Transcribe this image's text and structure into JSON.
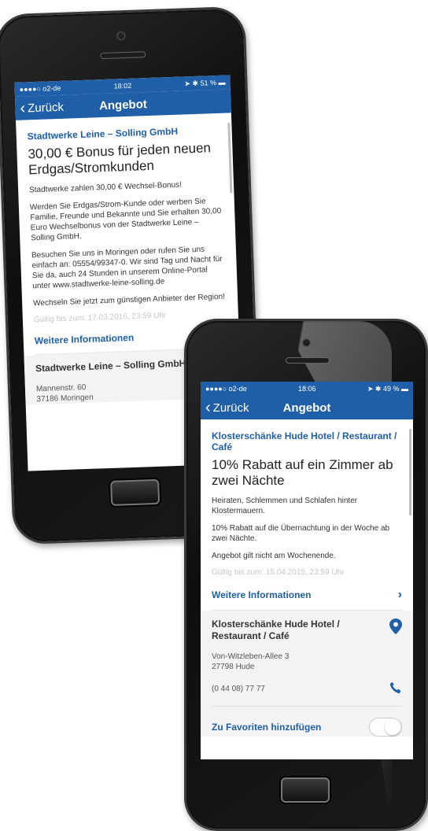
{
  "colors": {
    "accent": "#1f5fa8",
    "pin_icon": "#1f5fa8",
    "muted": "#c6c6c6"
  },
  "phone1": {
    "status": {
      "carrier": "●●●●○ o2-de",
      "time": "18:02",
      "battery": "51 %"
    },
    "nav": {
      "back_label": "Zurück",
      "title": "Angebot"
    },
    "offer": {
      "provider": "Stadtwerke Leine – Solling GmbH",
      "headline": "30,00 € Bonus für jeden neuen Erdgas/Stromkunden",
      "p1": "Stadtwerke zahlen 30,00 € Wechsel-Bonus!",
      "p2": "Werden Sie Erdgas/Strom-Kunde oder werben Sie Familie, Freunde und Bekannte und Sie erhalten 30,00 Euro Wechselbonus von der Stadtwerke Leine – Solling GmbH.",
      "p3": "Besuchen Sie uns in Moringen oder rufen Sie uns einfach an: 05554/99347-0. Wir sind Tag und Nacht für Sie da, auch 24 Stunden in unserem Online-Portal unter www.stadtwerke-leine-solling.de",
      "p4": "Wechseln Sie jetzt zum günstigen Anbieter der Region!",
      "valid": "Gültig bis zum: 17.03.2016, 23:59 Uhr",
      "more_label": "Weitere Informationen"
    },
    "address": {
      "name": "Stadtwerke Leine – Solling GmbH",
      "street": "Mannenstr. 60",
      "city": "37186 Moringen"
    }
  },
  "phone2": {
    "status": {
      "carrier": "●●●●○ o2-de",
      "time": "18:06",
      "battery": "49 %"
    },
    "nav": {
      "back_label": "Zurück",
      "title": "Angebot"
    },
    "offer": {
      "provider": "Klosterschänke Hude Hotel / Restaurant / Café",
      "headline": "10% Rabatt auf ein Zimmer ab zwei Nächte",
      "p1": "Heiraten, Schlemmen und Schlafen hinter Klostermauern.",
      "p2": "10% Rabatt auf die Übernachtung in der Woche ab zwei Nächte.",
      "p3": "Angebot gilt nicht am Wochenende.",
      "valid": "Gültig bis zum: 15.04.2015, 23:59 Uhr",
      "more_label": "Weitere Informationen"
    },
    "address": {
      "name": "Klosterschänke Hude Hotel / Restaurant / Café",
      "street": "Von-Witzleben-Allee 3",
      "city": "27798 Hude",
      "phone": "(0 44 08) 77 77"
    },
    "favorites_label": "Zu Favoriten hinzufügen"
  }
}
